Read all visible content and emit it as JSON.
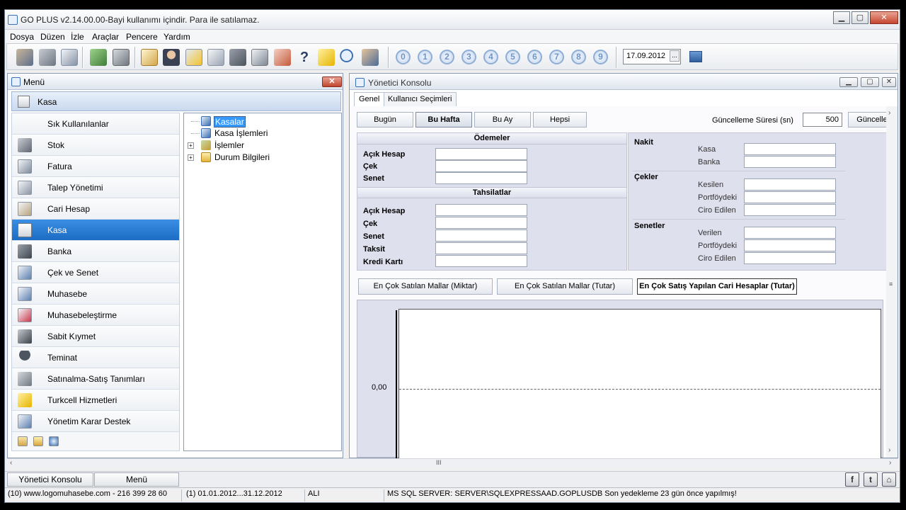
{
  "app": {
    "title": "GO PLUS v2.14.00.00-Bayi kullanımı içindir. Para ile satılamaz."
  },
  "menubar": [
    "Dosya",
    "Düzen",
    "İzle",
    "Araçlar",
    "Pencere",
    "Yardım"
  ],
  "toolbar": {
    "icons": [
      "users-icon",
      "factory-icon",
      "invoice-icon",
      "cash-icon",
      "calculator-icon",
      "clipboard-icon",
      "person-icon",
      "report-star-icon",
      "document-edit-icon",
      "shapes-icon",
      "documents-icon",
      "antenna-icon",
      "help-icon",
      "turkcell-icon",
      "search-icon",
      "user-settings-icon"
    ],
    "numbers": [
      "0",
      "1",
      "2",
      "3",
      "4",
      "5",
      "6",
      "7",
      "8",
      "9"
    ],
    "date": "17.09.2012",
    "date_button": "..."
  },
  "menu_panel": {
    "title": "Menü",
    "section_title": "Kasa",
    "items": [
      {
        "label": "Sık Kullanılanlar",
        "icon": "none"
      },
      {
        "label": "Stok",
        "icon": "stock-icon"
      },
      {
        "label": "Fatura",
        "icon": "invoice-icon"
      },
      {
        "label": "Talep Yönetimi",
        "icon": "request-icon"
      },
      {
        "label": "Cari Hesap",
        "icon": "account-card-icon"
      },
      {
        "label": "Kasa",
        "icon": "cashbox-icon",
        "selected": true
      },
      {
        "label": "Banka",
        "icon": "bank-icon"
      },
      {
        "label": "Çek ve Senet",
        "icon": "check-note-icon"
      },
      {
        "label": "Muhasebe",
        "icon": "ledger-icon"
      },
      {
        "label": "Muhasebeleştirme",
        "icon": "posting-icon"
      },
      {
        "label": "Sabit Kıymet",
        "icon": "fixed-asset-icon"
      },
      {
        "label": "Teminat",
        "icon": "umbrella-icon"
      },
      {
        "label": "Satınalma-Satış Tanımları",
        "icon": "cart-icon"
      },
      {
        "label": "Turkcell Hizmetleri",
        "icon": "turkcell-icon"
      },
      {
        "label": "Yönetim Karar Destek",
        "icon": "chart-icon"
      }
    ],
    "tree": [
      {
        "label": "Kasalar",
        "selected": true,
        "expandable": false
      },
      {
        "label": "Kasa İşlemleri",
        "selected": false,
        "expandable": false
      },
      {
        "label": "İşlemler",
        "selected": false,
        "expandable": true
      },
      {
        "label": "Durum Bilgileri",
        "selected": false,
        "expandable": true
      }
    ]
  },
  "console": {
    "title": "Yönetici Konsolu",
    "tabs": [
      "Genel",
      "Kullanıcı Seçimleri"
    ],
    "period_buttons": [
      "Bugün",
      "Bu Hafta",
      "Bu Ay",
      "Hepsi"
    ],
    "update_label": "Güncelleme Süresi (sn)",
    "update_value": "500",
    "update_button": "Güncelle",
    "payments": {
      "title": "Ödemeler",
      "fields": [
        "Açık Hesap",
        "Çek",
        "Senet"
      ]
    },
    "collections": {
      "title": "Tahsilatlar",
      "fields": [
        "Açık Hesap",
        "Çek",
        "Senet",
        "Taksit",
        "Kredi Kartı"
      ]
    },
    "cash": {
      "title": "Nakit",
      "fields": [
        "Kasa",
        "Banka"
      ]
    },
    "checks": {
      "title": "Çekler",
      "fields": [
        "Kesilen",
        "Portföydeki",
        "Ciro Edilen"
      ]
    },
    "notes": {
      "title": "Senetler",
      "fields": [
        "Verilen",
        "Portföydeki",
        "Ciro Edilen"
      ]
    },
    "chart_buttons": [
      "En Çok Satılan Mallar (Miktar)",
      "En Çok Satılan Mallar (Tutar)",
      "En Çok Satış Yapılan Cari Hesaplar (Tutar)"
    ],
    "chart_zero_label": "0,00"
  },
  "bottom_tabs": [
    "Yönetici Konsolu",
    "Menü"
  ],
  "social": [
    "f",
    "t",
    "⌂"
  ],
  "status": {
    "phone": "(10) www.logomuhasebe.com - 216 399 28 60",
    "period": "(1) 01.01.2012...31.12.2012",
    "user": "ALI",
    "server": "MS SQL SERVER: SERVER\\SQLEXPRESSAAD.GOPLUSDB Son yedekleme 23 gün önce yapılmış!"
  }
}
